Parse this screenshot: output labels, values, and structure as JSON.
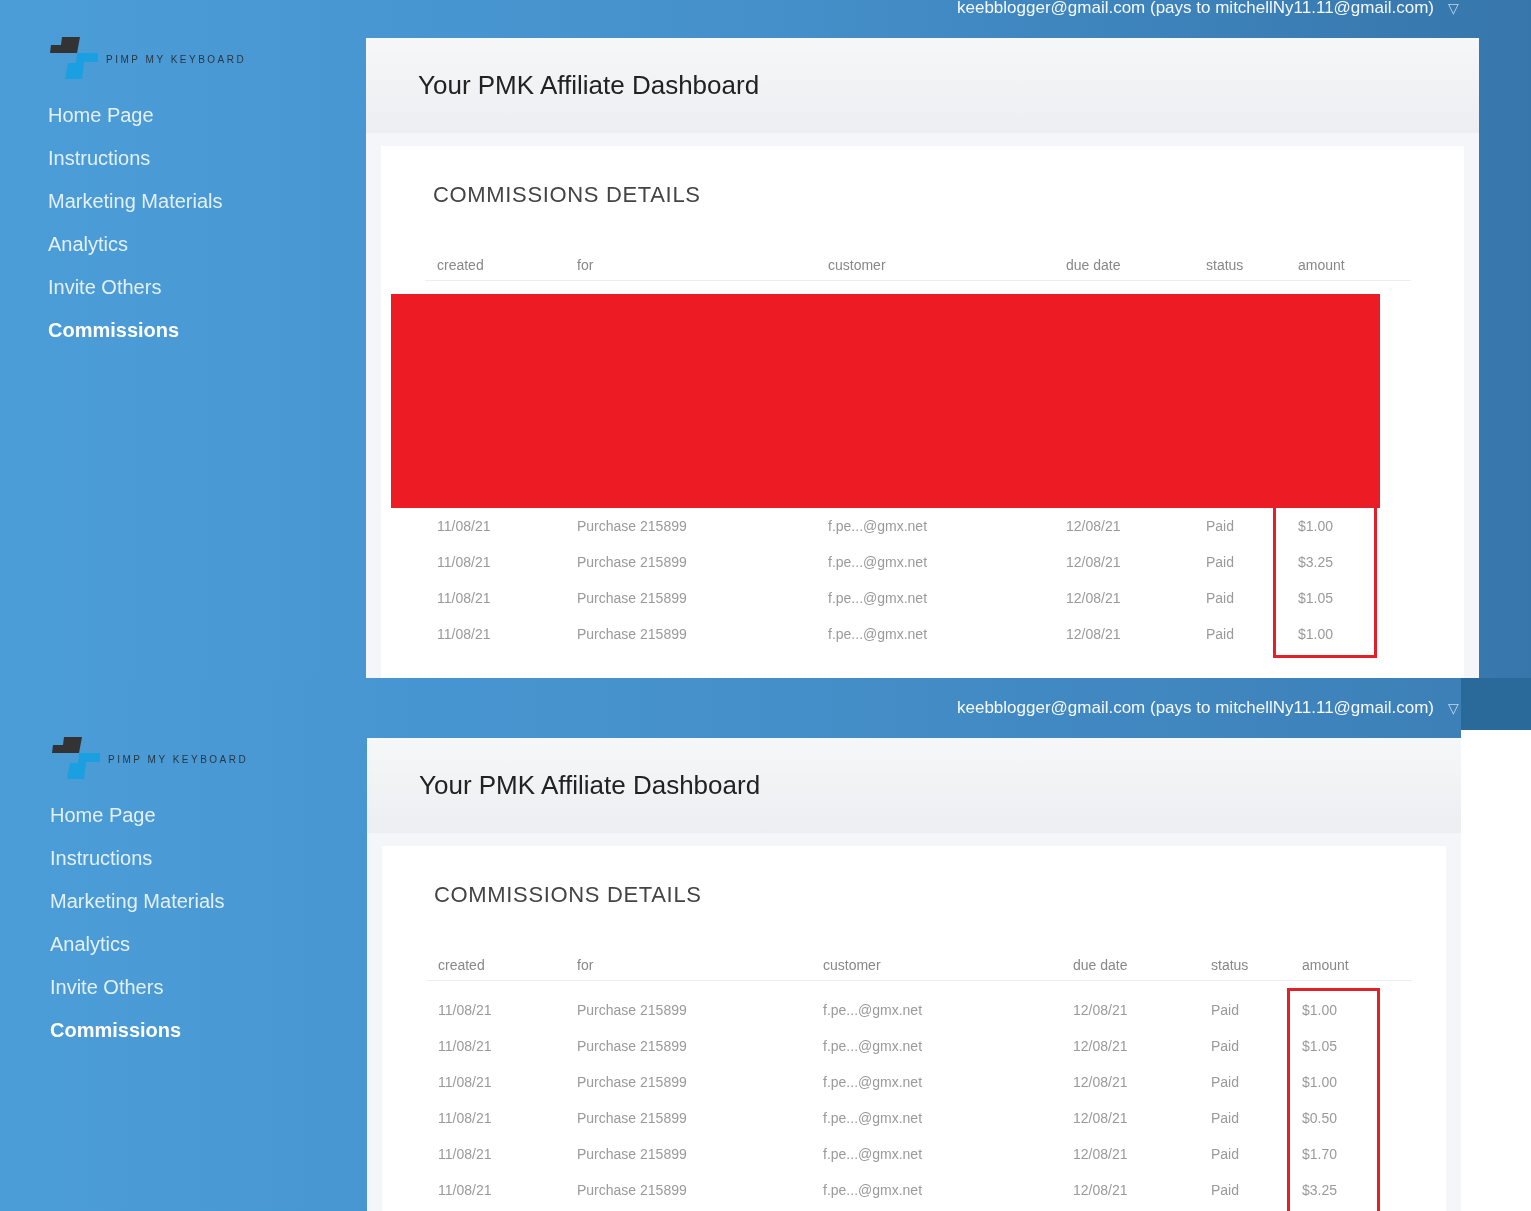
{
  "panels": [
    {
      "account": "keebblogger@gmail.com (pays to mitchellNy11.11@gmail.com)",
      "account_caret": "▽",
      "logo_text": "PIMP MY KEYBOARD",
      "nav": [
        {
          "label": "Home Page",
          "selected": false
        },
        {
          "label": "Instructions",
          "selected": false
        },
        {
          "label": "Marketing Materials",
          "selected": false
        },
        {
          "label": "Analytics",
          "selected": false
        },
        {
          "label": "Invite Others",
          "selected": false
        },
        {
          "label": "Commissions",
          "selected": true
        }
      ],
      "title": "Your PMK Affiliate Dashboard",
      "section_title": "COMMISSIONS DETAILS",
      "columns": [
        "created",
        "for",
        "customer",
        "due date",
        "status",
        "amount"
      ],
      "redacted_block": true,
      "amounts_highlighted": true,
      "rows": [
        [
          "11/08/21",
          "Purchase 215899",
          "f.pe...@gmx.net",
          "12/08/21",
          "Paid",
          "$1.00"
        ],
        [
          "11/08/21",
          "Purchase 215899",
          "f.pe...@gmx.net",
          "12/08/21",
          "Paid",
          "$3.25"
        ],
        [
          "11/08/21",
          "Purchase 215899",
          "f.pe...@gmx.net",
          "12/08/21",
          "Paid",
          "$1.05"
        ],
        [
          "11/08/21",
          "Purchase 215899",
          "f.pe...@gmx.net",
          "12/08/21",
          "Paid",
          "$1.00"
        ]
      ]
    },
    {
      "account": "keebblogger@gmail.com (pays to mitchellNy11.11@gmail.com)",
      "account_caret": "▽",
      "logo_text": "PIMP MY KEYBOARD",
      "nav": [
        {
          "label": "Home Page",
          "selected": false
        },
        {
          "label": "Instructions",
          "selected": false
        },
        {
          "label": "Marketing Materials",
          "selected": false
        },
        {
          "label": "Analytics",
          "selected": false
        },
        {
          "label": "Invite Others",
          "selected": false
        },
        {
          "label": "Commissions",
          "selected": true
        }
      ],
      "title": "Your PMK Affiliate Dashboard",
      "section_title": "COMMISSIONS DETAILS",
      "columns": [
        "created",
        "for",
        "customer",
        "due date",
        "status",
        "amount"
      ],
      "amounts_highlighted": true,
      "rows": [
        [
          "11/08/21",
          "Purchase 215899",
          "f.pe...@gmx.net",
          "12/08/21",
          "Paid",
          "$1.00"
        ],
        [
          "11/08/21",
          "Purchase 215899",
          "f.pe...@gmx.net",
          "12/08/21",
          "Paid",
          "$1.05"
        ],
        [
          "11/08/21",
          "Purchase 215899",
          "f.pe...@gmx.net",
          "12/08/21",
          "Paid",
          "$1.00"
        ],
        [
          "11/08/21",
          "Purchase 215899",
          "f.pe...@gmx.net",
          "12/08/21",
          "Paid",
          "$0.50"
        ],
        [
          "11/08/21",
          "Purchase 215899",
          "f.pe...@gmx.net",
          "12/08/21",
          "Paid",
          "$1.70"
        ],
        [
          "11/08/21",
          "Purchase 215899",
          "f.pe...@gmx.net",
          "12/08/21",
          "Paid",
          "$3.25"
        ]
      ]
    }
  ]
}
